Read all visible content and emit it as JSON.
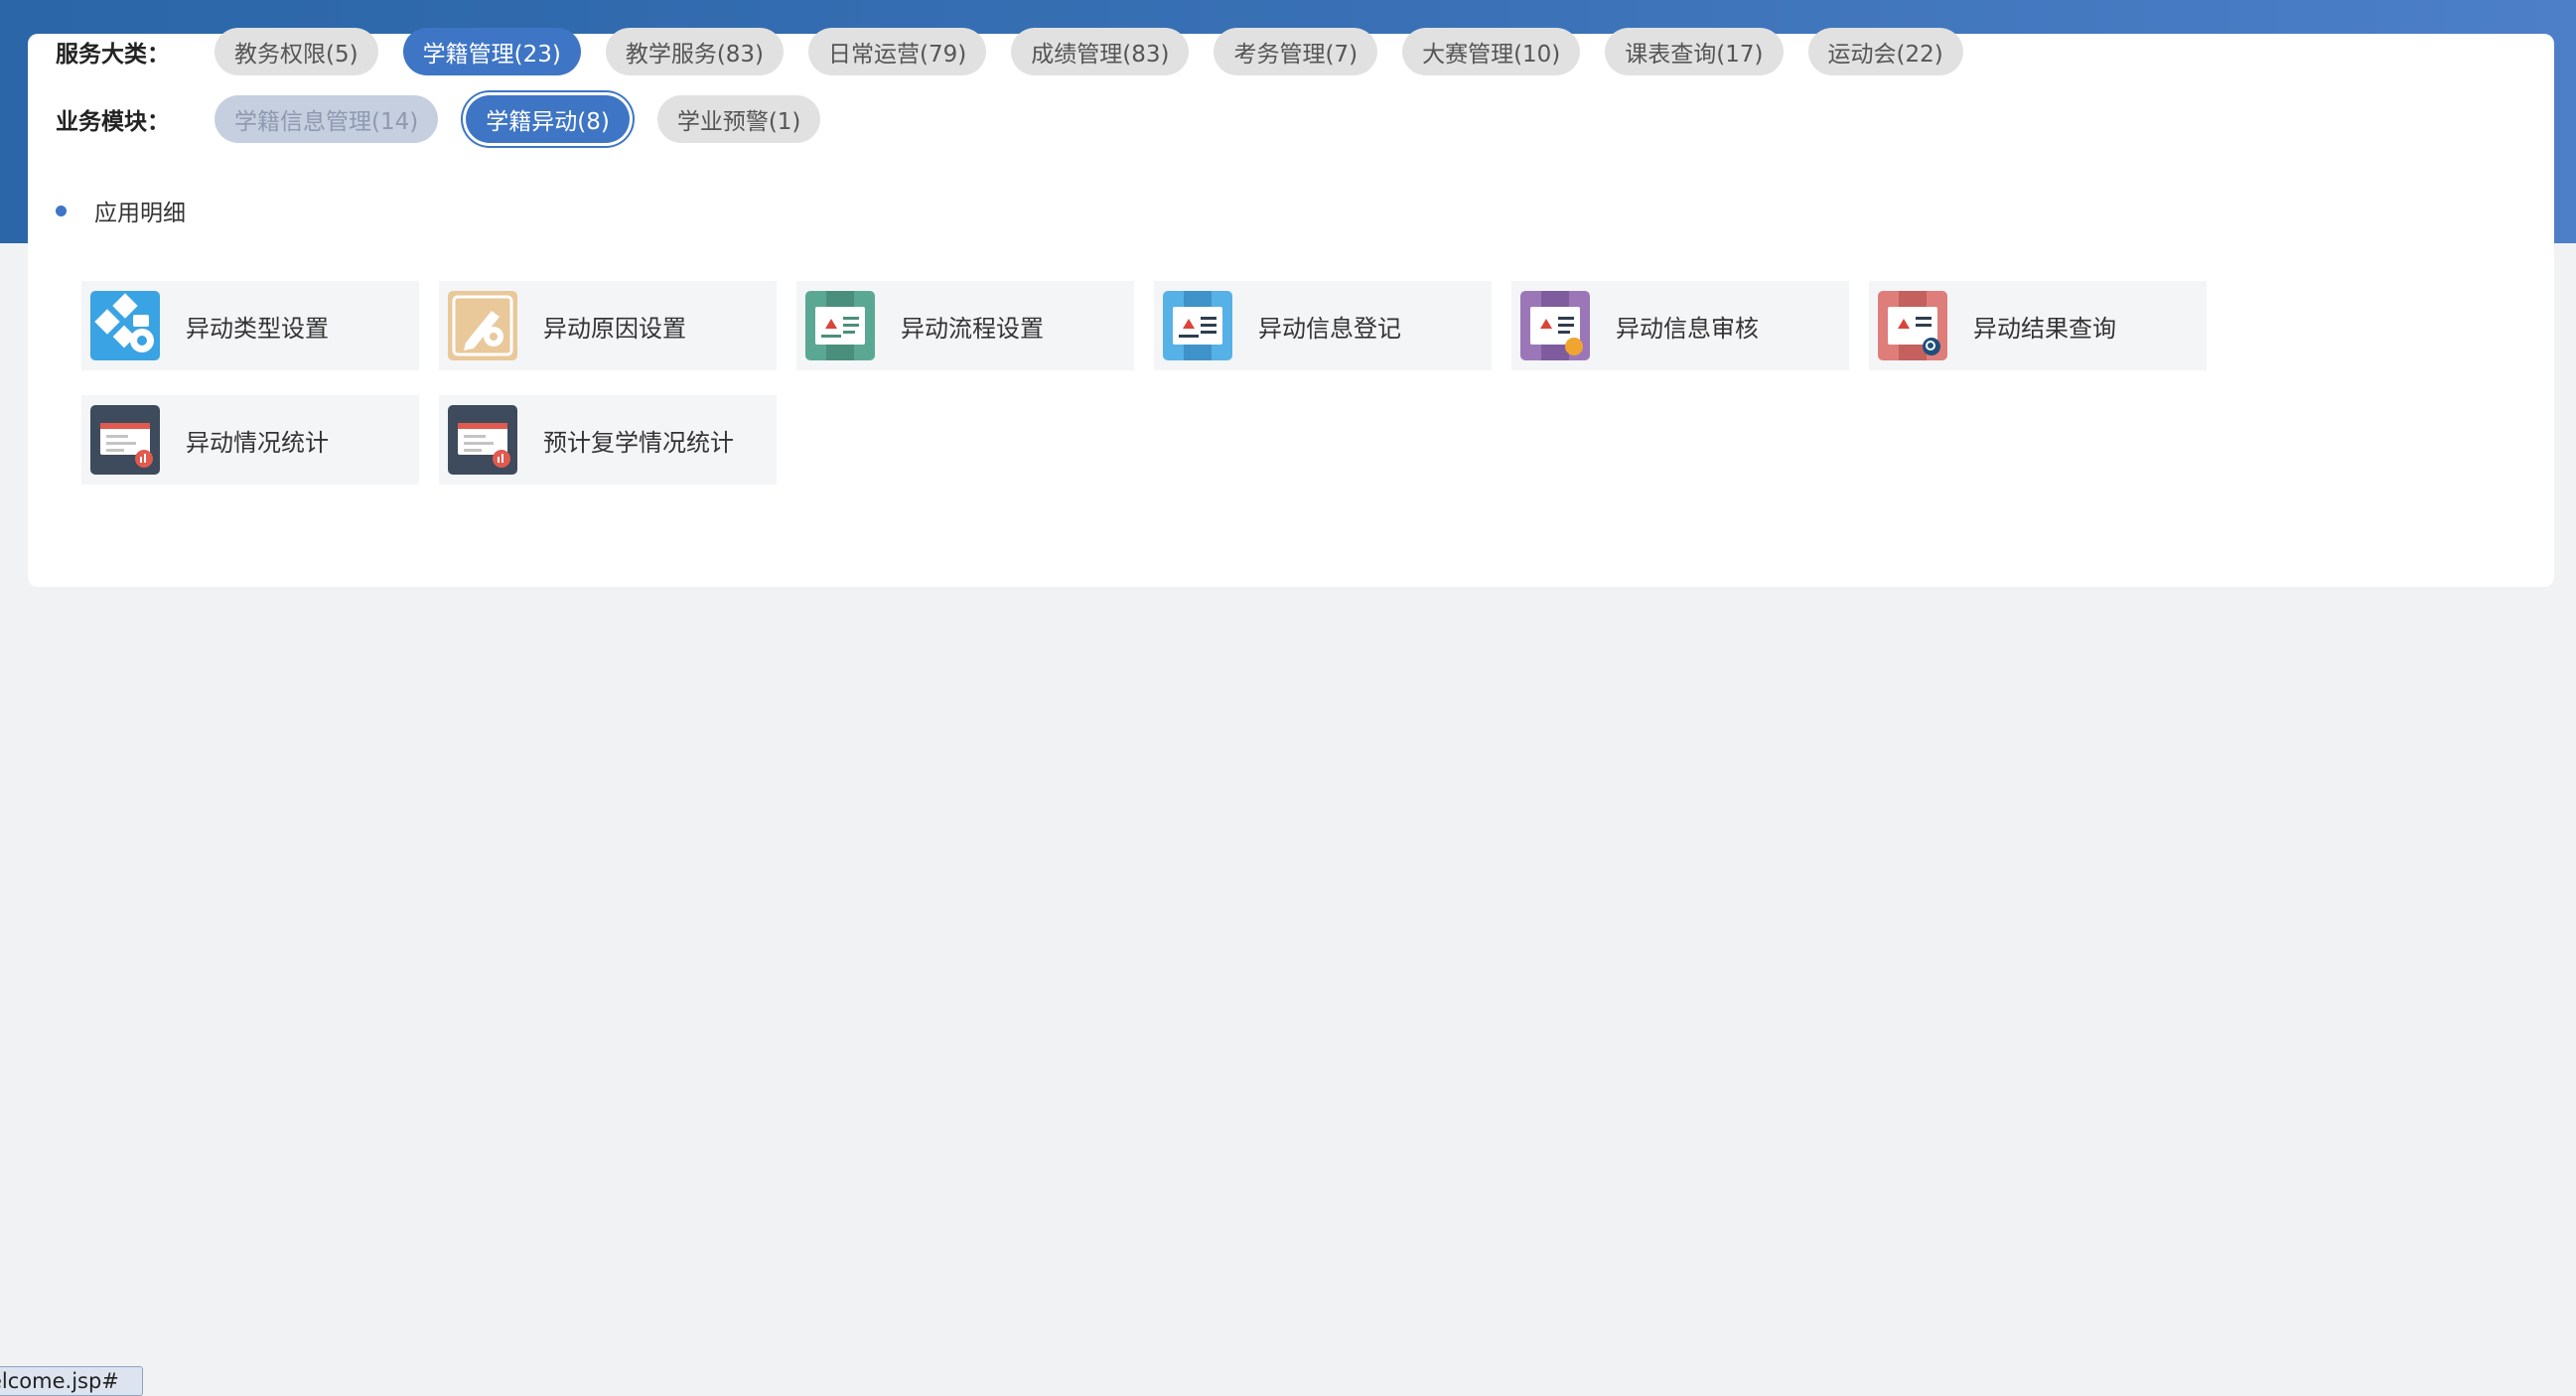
{
  "filters": {
    "category_label": "服务大类：",
    "categories": [
      {
        "label": "教务权限(5)",
        "state": "normal"
      },
      {
        "label": "学籍管理(23)",
        "state": "active"
      },
      {
        "label": "教学服务(83)",
        "state": "normal"
      },
      {
        "label": "日常运营(79)",
        "state": "normal"
      },
      {
        "label": "成绩管理(83)",
        "state": "normal"
      },
      {
        "label": "考务管理(7)",
        "state": "normal"
      },
      {
        "label": "大赛管理(10)",
        "state": "normal"
      },
      {
        "label": "课表查询(17)",
        "state": "normal"
      },
      {
        "label": "运动会(22)",
        "state": "normal"
      }
    ],
    "module_label": "业务模块：",
    "modules": [
      {
        "label": "学籍信息管理(14)",
        "state": "disabled"
      },
      {
        "label": "学籍异动(8)",
        "state": "selected"
      },
      {
        "label": "学业预警(1)",
        "state": "normal"
      }
    ]
  },
  "section": {
    "title": "应用明细"
  },
  "apps": [
    {
      "label": "异动类型设置",
      "icon": "type-settings-icon",
      "color": "#3aa3e3"
    },
    {
      "label": "异动原因设置",
      "icon": "reason-settings-icon",
      "color": "#e9c89a"
    },
    {
      "label": "异动流程设置",
      "icon": "process-settings-icon",
      "color": "#4f9a86"
    },
    {
      "label": "异动信息登记",
      "icon": "info-register-icon",
      "color": "#3f9fd6"
    },
    {
      "label": "异动信息审核",
      "icon": "info-review-icon",
      "color": "#8b66a8"
    },
    {
      "label": "异动结果查询",
      "icon": "result-query-icon",
      "color": "#cf6d6a"
    },
    {
      "label": "异动情况统计",
      "icon": "change-stats-icon",
      "color": "#3d4b5c"
    },
    {
      "label": "预计复学情况统计",
      "icon": "resume-stats-icon",
      "color": "#3d4b5c"
    }
  ],
  "status_bar": {
    "url_fragment": "elcome.jsp#"
  }
}
